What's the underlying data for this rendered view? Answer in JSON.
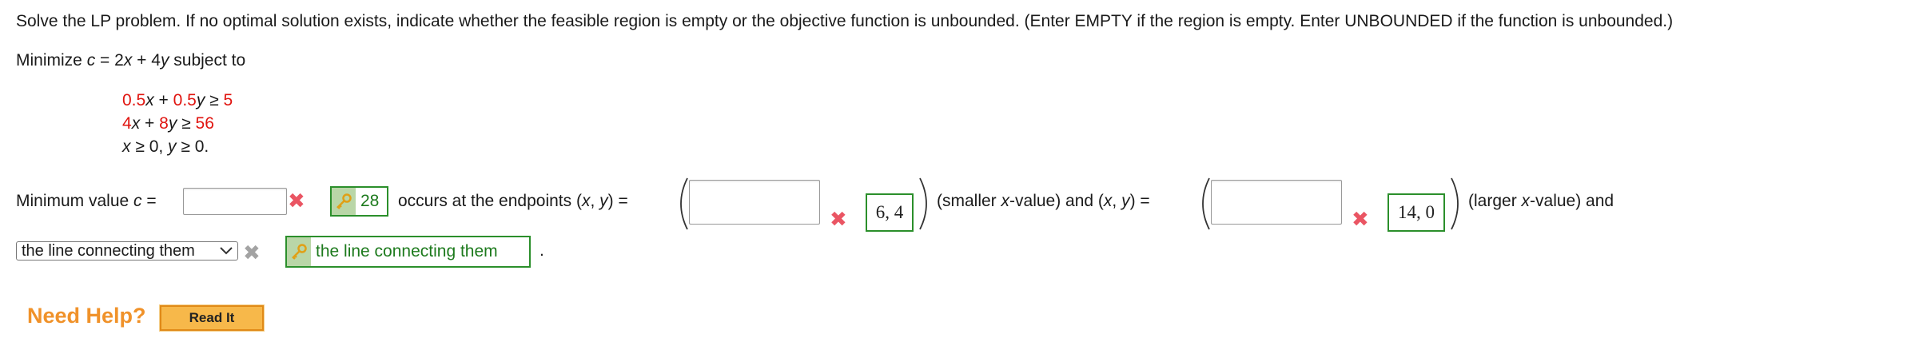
{
  "problem": {
    "instruction": "Solve the LP problem. If no optimal solution exists, indicate whether the feasible region is empty or the objective function is unbounded. (Enter EMPTY if the region is empty. Enter UNBOUNDED if the function is unbounded.)",
    "objective_prefix": "Minimize ",
    "objective_var": "c",
    "objective_eq": " = 2",
    "x": "x",
    "plus4": " + 4",
    "y": "y",
    "subject_to": " subject to",
    "c1_a": "0.5",
    "c1_plus": " + ",
    "c1_b": "0.5",
    "c1_ge": " ≥ ",
    "c1_rhs": "5",
    "c2_a": "4",
    "c2_plus": " + ",
    "c2_b": "8",
    "c2_ge": " ≥ ",
    "c2_rhs": "56",
    "nonneg_1": " ≥ 0, ",
    "nonneg_2": " ≥ 0."
  },
  "answer_row": {
    "min_label_prefix": "Minimum value ",
    "min_label_var": "c",
    "min_label_eq": " =",
    "min_value_input": "",
    "min_correct": "28",
    "occurs_text": "occurs at the endpoints (",
    "xy_x": "x",
    "xy_comma": ", ",
    "xy_y": "y",
    "xy_eq": ") =",
    "endpoint1_input": "",
    "endpoint1_correct": "6, 4",
    "smaller_text_a": "(smaller ",
    "smaller_var": "x",
    "smaller_text_b": "-value) and (",
    "and_xy_x": "x",
    "and_xy_comma": ", ",
    "and_xy_y": "y",
    "and_xy_eq": ") =",
    "endpoint2_input": "",
    "endpoint2_correct": "14, 0",
    "larger_text_a": "(larger ",
    "larger_var": "x",
    "larger_text_b": "-value) and"
  },
  "select_row": {
    "selected": "the line connecting them",
    "correct": "the line connecting them",
    "period": "."
  },
  "help": {
    "label": "Need Help?",
    "read_button": "Read It"
  },
  "icons": {
    "wrong": "x-mark-icon",
    "key": "key-icon",
    "dropdown": "chevron-down-icon"
  },
  "colors": {
    "constraint_numbers": "#e0140f",
    "correct_green": "#2b8f2b",
    "wrong_red": "#ea5563",
    "help_orange": "#f0922a"
  }
}
